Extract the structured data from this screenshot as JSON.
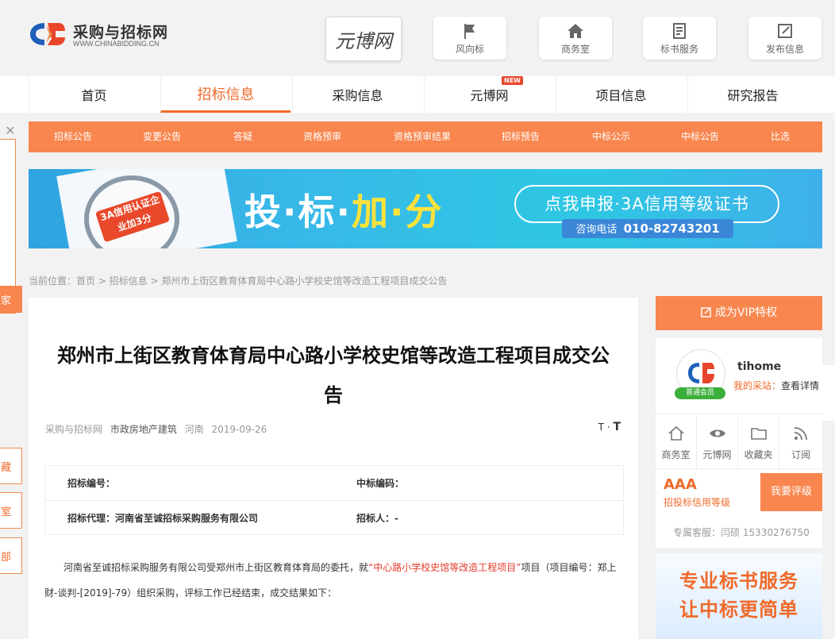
{
  "header": {
    "logo_cn": "采购与招标网",
    "logo_en": "WWW.CHINABIDDING.CN",
    "partner_logo": "元博网",
    "buttons": [
      {
        "label": "风向标",
        "icon": "flag-icon"
      },
      {
        "label": "商务室",
        "icon": "home-icon"
      },
      {
        "label": "标书服务",
        "icon": "document-icon"
      },
      {
        "label": "发布信息",
        "icon": "edit-icon"
      }
    ]
  },
  "nav": {
    "items": [
      "首页",
      "招标信息",
      "采购信息",
      "元博网",
      "项目信息",
      "研究报告"
    ],
    "active": "招标信息",
    "new_badge": "NEW"
  },
  "subnav": {
    "items": [
      "招标公告",
      "变更公告",
      "答疑",
      "资格预审",
      "资格预审结果",
      "招标预告",
      "中标公示",
      "中标公告",
      "比选"
    ]
  },
  "banner": {
    "badge": "3A信用认证企业加3分",
    "main_a": "投·标·",
    "main_b": "加·分",
    "pill": "点我申报·3A信用等级证书",
    "phone_label": "咨询电话",
    "phone": "010-82743201"
  },
  "left_float": {
    "close": "✕",
    "buttons": [
      "藏",
      "室",
      "部",
      "家"
    ]
  },
  "breadcrumb": "当前位置：首页 > 招标信息 > 郑州市上街区教育体育局中心路小学校史馆等改造工程项目成交公告",
  "article": {
    "title": "郑州市上街区教育体育局中心路小学校史馆等改造工程项目成交公告",
    "source": "采购与招标网",
    "category": "市政房地产建筑",
    "region": "河南",
    "date": "2019-09-26",
    "font_toggle_small": "T",
    "font_toggle_sep": "·",
    "font_toggle_large": "T",
    "info": {
      "bid_no_label": "招标编号：",
      "win_code_label": "中标编码：",
      "agent_label": "招标代理：河南省至诚招标采购服务有限公司",
      "tenderer_label": "招标人：-"
    },
    "para_a": "河南省至诚招标采购服务有限公司受郑州市上街区教育体育局的委托，就",
    "para_project": "“中心路小学校史馆等改造工程项目”",
    "para_b": "项目（项目编号：郑上财-谈判-[2019]-79）组织采购，评标工作已经结束，成交结果如下："
  },
  "sidebar": {
    "vip": "成为VIP特权",
    "username": "tihome",
    "badge": "普通会员",
    "my_shop": "我的采站：",
    "view": "查看详情",
    "icons": [
      {
        "label": "商务室",
        "icon": "home-icon"
      },
      {
        "label": "元博网",
        "icon": "eye-icon"
      },
      {
        "label": "收藏夹",
        "icon": "folder-icon"
      },
      {
        "label": "订阅",
        "icon": "rss-icon"
      }
    ],
    "rating": "AAA",
    "rating_sub": "招投标信用等级",
    "rate_btn": "我要评级",
    "service": "专属客服：闫硕 15330276750",
    "promo_l1": "专业标书服务",
    "promo_l2": "让中标更简单"
  },
  "colors": {
    "accent": "#f8864e",
    "active": "#f06a2a",
    "link_red": "#e43b2b",
    "banner": "#2fa4e0"
  }
}
